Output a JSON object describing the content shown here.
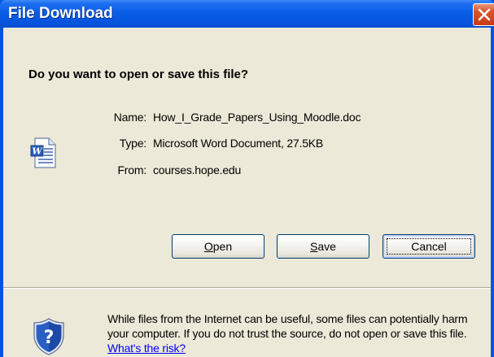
{
  "dialog": {
    "title": "File Download",
    "question": "Do you want to open or save this file?"
  },
  "file": {
    "name_label": "Name:",
    "name": "How_I_Grade_Papers_Using_Moodle.doc",
    "type_label": "Type:",
    "type": "Microsoft Word Document, 27.5KB",
    "from_label": "From:",
    "from": "courses.hope.edu"
  },
  "buttons": {
    "open_pre": "",
    "open_accel": "O",
    "open_post": "pen",
    "save_pre": "",
    "save_accel": "S",
    "save_post": "ave",
    "cancel": "Cancel"
  },
  "warning": {
    "text": "While files from the Internet can be useful, some files can potentially harm your computer. If you do not trust the source, do not open or save this file.",
    "link": "What's the risk?"
  },
  "icons": {
    "close": "close-icon",
    "document": "word-document-icon",
    "security": "security-shield-icon"
  },
  "colors": {
    "titlebar": "#0a5ee6",
    "close_button": "#d9542c",
    "dialog_body": "#ece9d8",
    "link": "#0000ff"
  }
}
